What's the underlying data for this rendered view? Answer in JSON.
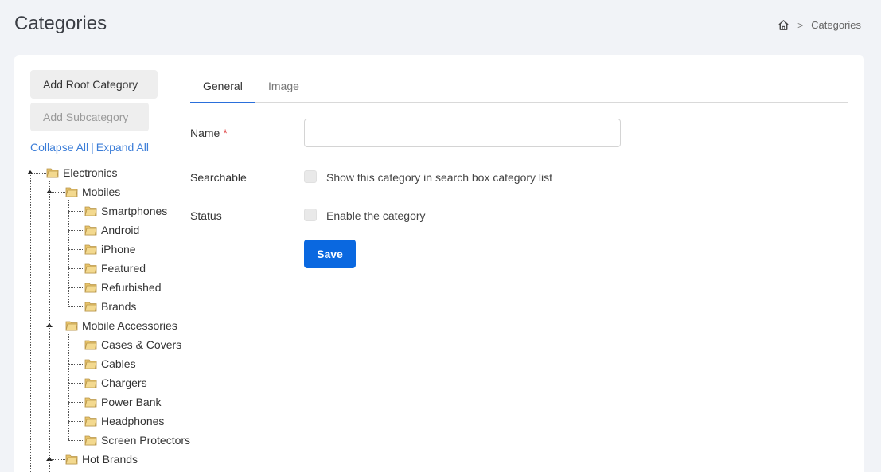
{
  "header": {
    "title": "Categories",
    "breadcrumb": {
      "home_icon": "home-icon",
      "separator": ">",
      "current": "Categories"
    }
  },
  "sidebar": {
    "add_root_label": "Add Root Category",
    "add_sub_label": "Add Subcategory",
    "collapse_all": "Collapse All",
    "link_separator": "|",
    "expand_all": "Expand All",
    "tree": [
      {
        "label": "Electronics",
        "children": [
          {
            "label": "Mobiles",
            "children": [
              {
                "label": "Smartphones"
              },
              {
                "label": "Android"
              },
              {
                "label": "iPhone"
              },
              {
                "label": "Featured"
              },
              {
                "label": "Refurbished"
              },
              {
                "label": "Brands"
              }
            ]
          },
          {
            "label": "Mobile Accessories",
            "children": [
              {
                "label": "Cases & Covers"
              },
              {
                "label": "Cables"
              },
              {
                "label": "Chargers"
              },
              {
                "label": "Power Bank"
              },
              {
                "label": "Headphones"
              },
              {
                "label": "Screen Protectors"
              }
            ]
          },
          {
            "label": "Hot Brands",
            "children": []
          }
        ]
      }
    ]
  },
  "tabs": {
    "general": "General",
    "image": "Image"
  },
  "form": {
    "name_label": "Name",
    "required_marker": "*",
    "name_value": "",
    "searchable_label": "Searchable",
    "searchable_text": "Show this category in search box category list",
    "status_label": "Status",
    "status_text": "Enable the category",
    "save_label": "Save"
  },
  "colors": {
    "accent": "#0a68e0",
    "link": "#3b7dd8",
    "required": "#e04444",
    "folder": "#e8c46a"
  }
}
